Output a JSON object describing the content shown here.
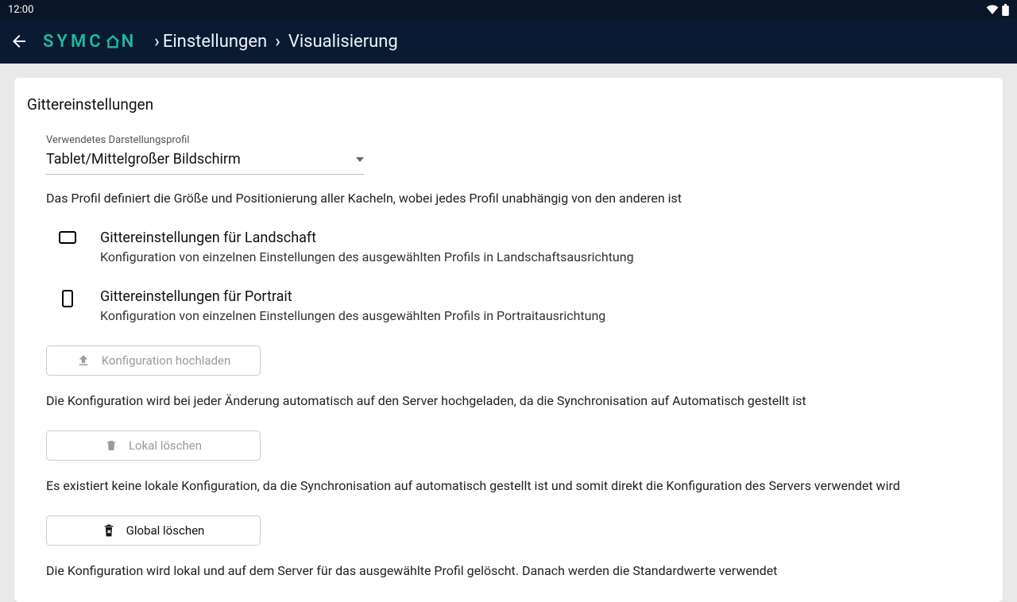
{
  "status": {
    "time": "12:00"
  },
  "header": {
    "logo_text": "SYMC",
    "logo_text2": "N",
    "crumb1": "Einstellungen",
    "crumb2": "Visualisierung"
  },
  "section": {
    "title": "Gittereinstellungen",
    "profile_label": "Verwendetes Darstellungsprofil",
    "profile_value": "Tablet/Mittelgroßer Bildschirm",
    "profile_desc": "Das Profil definiert die Größe und Positionierung aller Kacheln, wobei jedes Profil unabhängig von den anderen ist",
    "landscape": {
      "title": "Gittereinstellungen für Landschaft",
      "sub": "Konfiguration von einzelnen Einstellungen des ausgewählten Profils in Landschaftsausrichtung"
    },
    "portrait": {
      "title": "Gittereinstellungen für Portrait",
      "sub": "Konfiguration von einzelnen Einstellungen des ausgewählten Profils in Portraitausrichtung"
    },
    "upload_btn": "Konfiguration hochladen",
    "upload_note": "Die Konfiguration wird bei jeder Änderung automatisch auf den Server hochgeladen, da die Synchronisation auf Automatisch gestellt ist",
    "local_delete_btn": "Lokal löschen",
    "local_note": "Es existiert keine lokale Konfiguration, da die Synchronisation auf automatisch gestellt ist und somit direkt die Konfiguration des Servers verwendet wird",
    "global_delete_btn": "Global löschen",
    "global_note": "Die Konfiguration wird lokal und auf dem Server für das ausgewählte Profil gelöscht. Danach werden die Standardwerte verwendet"
  }
}
